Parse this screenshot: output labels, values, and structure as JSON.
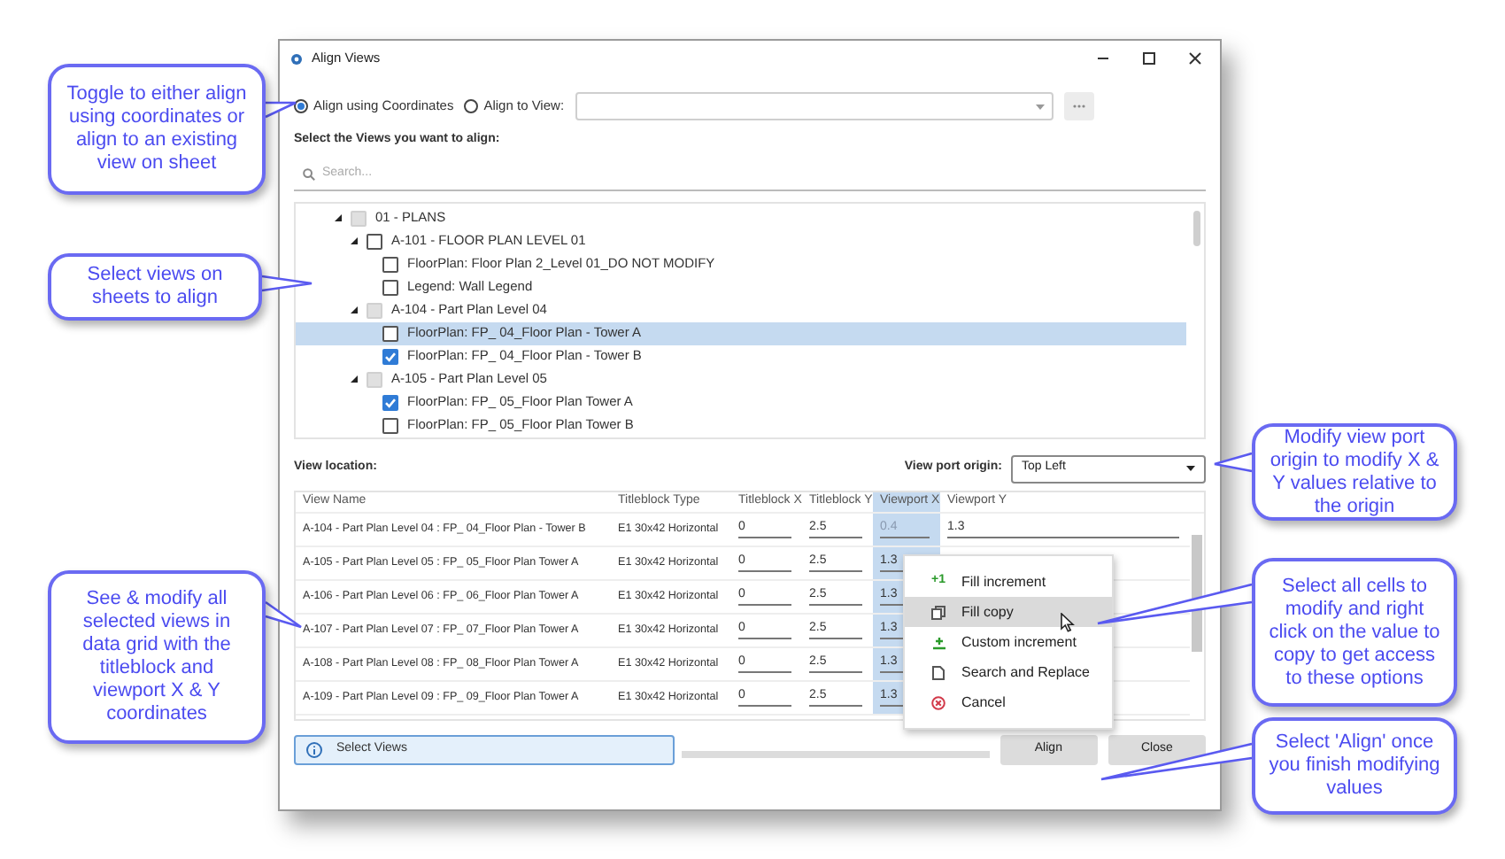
{
  "window": {
    "title": "Align Views"
  },
  "align_mode": [
    {
      "label": "Align using Coordinates",
      "selected": true
    },
    {
      "label": "Align to View:",
      "selected": false
    }
  ],
  "views_label": "Select the Views you want to align:",
  "search": {
    "placeholder": "Search..."
  },
  "tree": [
    {
      "label": "01 - PLANS",
      "checked": false,
      "partial": true,
      "expanded": true,
      "selected": false,
      "children": [
        {
          "label": "A-101 - FLOOR PLAN LEVEL 01",
          "checked": false,
          "partial": false,
          "expanded": true,
          "selected": false,
          "children": [
            {
              "label": "FloorPlan: Floor Plan 2_Level 01_DO NOT MODIFY",
              "checked": false,
              "partial": false,
              "selected": false
            },
            {
              "label": "Legend: Wall Legend",
              "checked": false,
              "partial": false,
              "selected": false
            }
          ]
        },
        {
          "label": "A-104 - Part Plan Level 04",
          "checked": false,
          "partial": true,
          "expanded": true,
          "selected": false,
          "children": [
            {
              "label": "FloorPlan: FP_ 04_Floor Plan - Tower A",
              "checked": false,
              "partial": false,
              "selected": true
            },
            {
              "label": "FloorPlan: FP_ 04_Floor Plan - Tower B",
              "checked": true,
              "partial": false,
              "selected": false
            }
          ]
        },
        {
          "label": "A-105 - Part Plan Level 05",
          "checked": false,
          "partial": true,
          "expanded": true,
          "selected": false,
          "children": [
            {
              "label": "FloorPlan: FP_ 05_Floor Plan Tower A",
              "checked": true,
              "partial": false,
              "selected": false
            },
            {
              "label": "FloorPlan: FP_ 05_Floor Plan Tower B",
              "checked": false,
              "partial": false,
              "selected": false
            }
          ]
        }
      ]
    }
  ],
  "view_location_label": "View location:",
  "origin": {
    "label": "View port origin:",
    "value": "Top Left"
  },
  "grid": {
    "columns": [
      {
        "label": "View Name",
        "selected": false
      },
      {
        "label": "Titleblock Type",
        "selected": false
      },
      {
        "label": "Titleblock X",
        "selected": false
      },
      {
        "label": "Titleblock Y",
        "selected": false
      },
      {
        "label": "Viewport X",
        "selected": true
      },
      {
        "label": "Viewport Y",
        "selected": false
      }
    ],
    "rows": [
      [
        "A-104 - Part Plan Level 04 : FP_ 04_Floor Plan - Tower B",
        "E1 30x42 Horizontal",
        "0",
        "2.5",
        "0.4",
        "1.3"
      ],
      [
        "A-105 - Part Plan Level 05 : FP_ 05_Floor Plan Tower A",
        "E1 30x42 Horizontal",
        "0",
        "2.5",
        "1.3"
      ],
      [
        "A-106 - Part Plan Level 06 : FP_ 06_Floor Plan Tower A",
        "E1 30x42 Horizontal",
        "0",
        "2.5",
        "1.3"
      ],
      [
        "A-107 - Part Plan Level 07 : FP_ 07_Floor Plan Tower A",
        "E1 30x42 Horizontal",
        "0",
        "2.5",
        "1.3"
      ],
      [
        "A-108 - Part Plan Level 08 : FP_ 08_Floor Plan Tower A",
        "E1 30x42 Horizontal",
        "0",
        "2.5",
        "1.3"
      ],
      [
        "A-109 - Part Plan Level 09 : FP_ 09_Floor Plan Tower A",
        "E1 30x42 Horizontal",
        "0",
        "2.5",
        "1.3"
      ]
    ]
  },
  "context_menu": [
    {
      "kind": "increment",
      "icon_text": "+1",
      "label": "Fill increment",
      "selected": false
    },
    {
      "kind": "copy",
      "label": "Fill copy",
      "selected": true
    },
    {
      "kind": "custom",
      "label": "Custom increment",
      "selected": false
    },
    {
      "kind": "replace",
      "label": "Search and Replace",
      "selected": false
    },
    {
      "kind": "cancel",
      "label": "Cancel",
      "selected": false
    }
  ],
  "status": "Select Views",
  "progress": {
    "level": 0
  },
  "buttons": [
    "Align",
    "Close"
  ],
  "callouts": [
    "Toggle to either align using coordinates or align to an existing view on sheet",
    "Select views on sheets to align",
    "See & modify all selected views in data grid with the titleblock and viewport X & Y coordinates",
    "Modify view port origin to modify X & Y values relative to the origin",
    "Select all cells to modify and right click on the value to copy to get access to these options",
    "Select 'Align' once you finish modifying values"
  ]
}
